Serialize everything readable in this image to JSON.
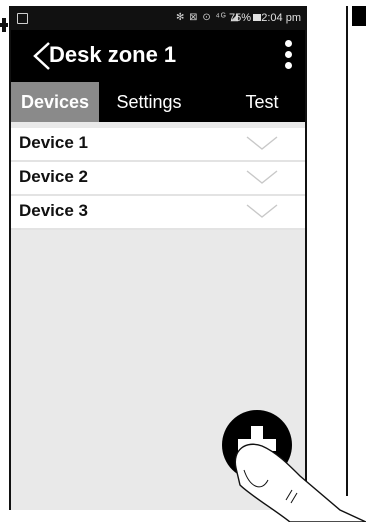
{
  "status_bar": {
    "icons": "✻ ⊠ ⊙ ⁴ᴳ ◢",
    "battery": "75%",
    "time": "2:04 pm"
  },
  "header": {
    "title": "Desk zone 1"
  },
  "tabs": [
    {
      "label": "Devices",
      "active": true
    },
    {
      "label": "Settings",
      "active": false
    },
    {
      "label": "Test",
      "active": false
    }
  ],
  "devices": [
    {
      "label": "Device 1"
    },
    {
      "label": "Device 2"
    },
    {
      "label": "Device 3"
    }
  ],
  "icons": {
    "back": "chevron-left-icon",
    "menu": "more-vertical-icon",
    "expand": "chevron-down-icon",
    "add": "plus-icon"
  },
  "colors": {
    "header_bg": "#000000",
    "active_tab_bg": "#8a8a8a",
    "list_bg": "#e9e9e9"
  }
}
